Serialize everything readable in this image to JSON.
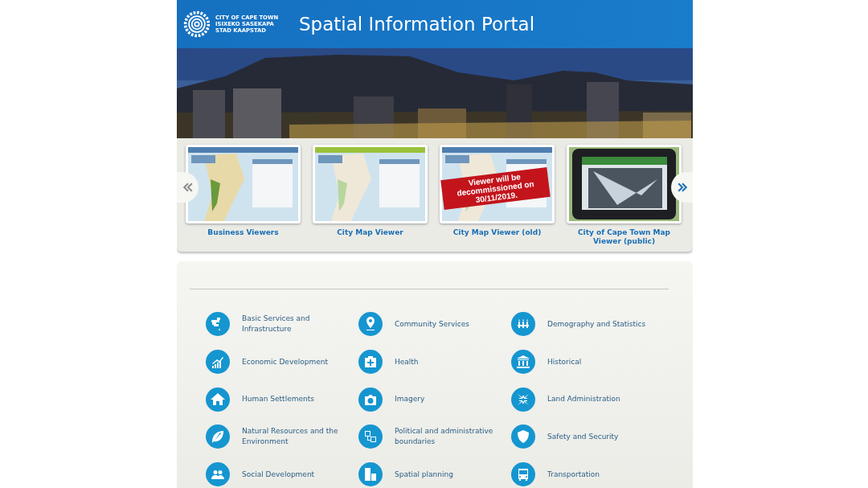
{
  "header": {
    "logo_lines": [
      "CITY OF CAPE TOWN",
      "ISIXEKO SASEKAPA",
      "STAD KAAPSTAD"
    ],
    "title": "Spatial Information Portal"
  },
  "carousel": {
    "items": [
      {
        "caption": "Business Viewers"
      },
      {
        "caption": "City Map Viewer"
      },
      {
        "caption": "City Map Viewer (old)",
        "ribbon": "Viewer will be decommissioned on 30/11/2019."
      },
      {
        "caption": "City of Cape Town Map Viewer (public)"
      }
    ]
  },
  "categories": [
    {
      "label": "Basic Services and Infrastructure"
    },
    {
      "label": "Community Services"
    },
    {
      "label": "Demography and Statistics"
    },
    {
      "label": "Economic Development"
    },
    {
      "label": "Health"
    },
    {
      "label": "Historical"
    },
    {
      "label": "Human Settlements"
    },
    {
      "label": "Imagery"
    },
    {
      "label": "Land Administration"
    },
    {
      "label": "Natural Resources and the Environment"
    },
    {
      "label": "Political and administrative boundaries"
    },
    {
      "label": "Safety and Security"
    },
    {
      "label": "Social Development"
    },
    {
      "label": "Spatial planning"
    },
    {
      "label": "Transportation"
    }
  ]
}
